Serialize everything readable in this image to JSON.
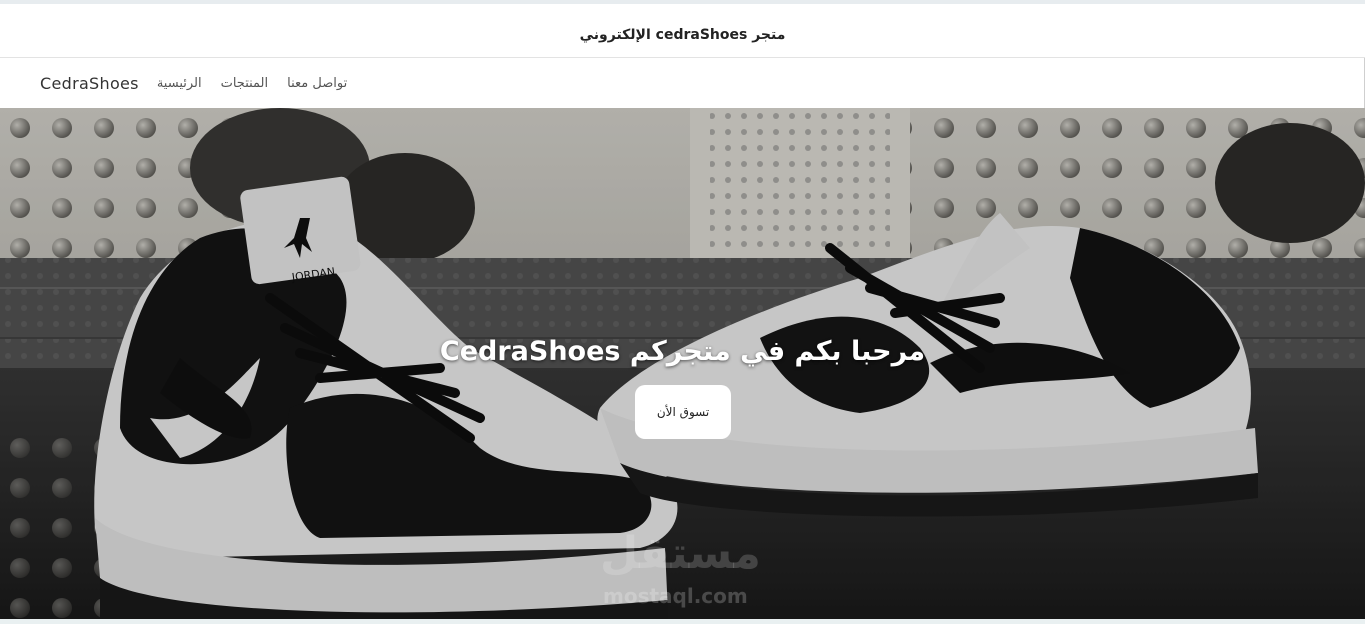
{
  "announcement": {
    "text": "متجر cedraShoes الإلكتروني"
  },
  "navbar": {
    "brand": "CedraShoes",
    "links": [
      {
        "label": "الرئيسية"
      },
      {
        "label": "المنتجات"
      },
      {
        "label": "تواصل معنا"
      }
    ]
  },
  "hero": {
    "title": "مرحبا بكم في متجركم CedraShoes",
    "button_label": "تسوق الأن",
    "watermark_ar": "مستقل",
    "watermark_en": "mostaql.com"
  },
  "colors": {
    "hero_text": "#ffffff",
    "button_bg": "#ffffff",
    "wall": "#cfcdc4"
  }
}
